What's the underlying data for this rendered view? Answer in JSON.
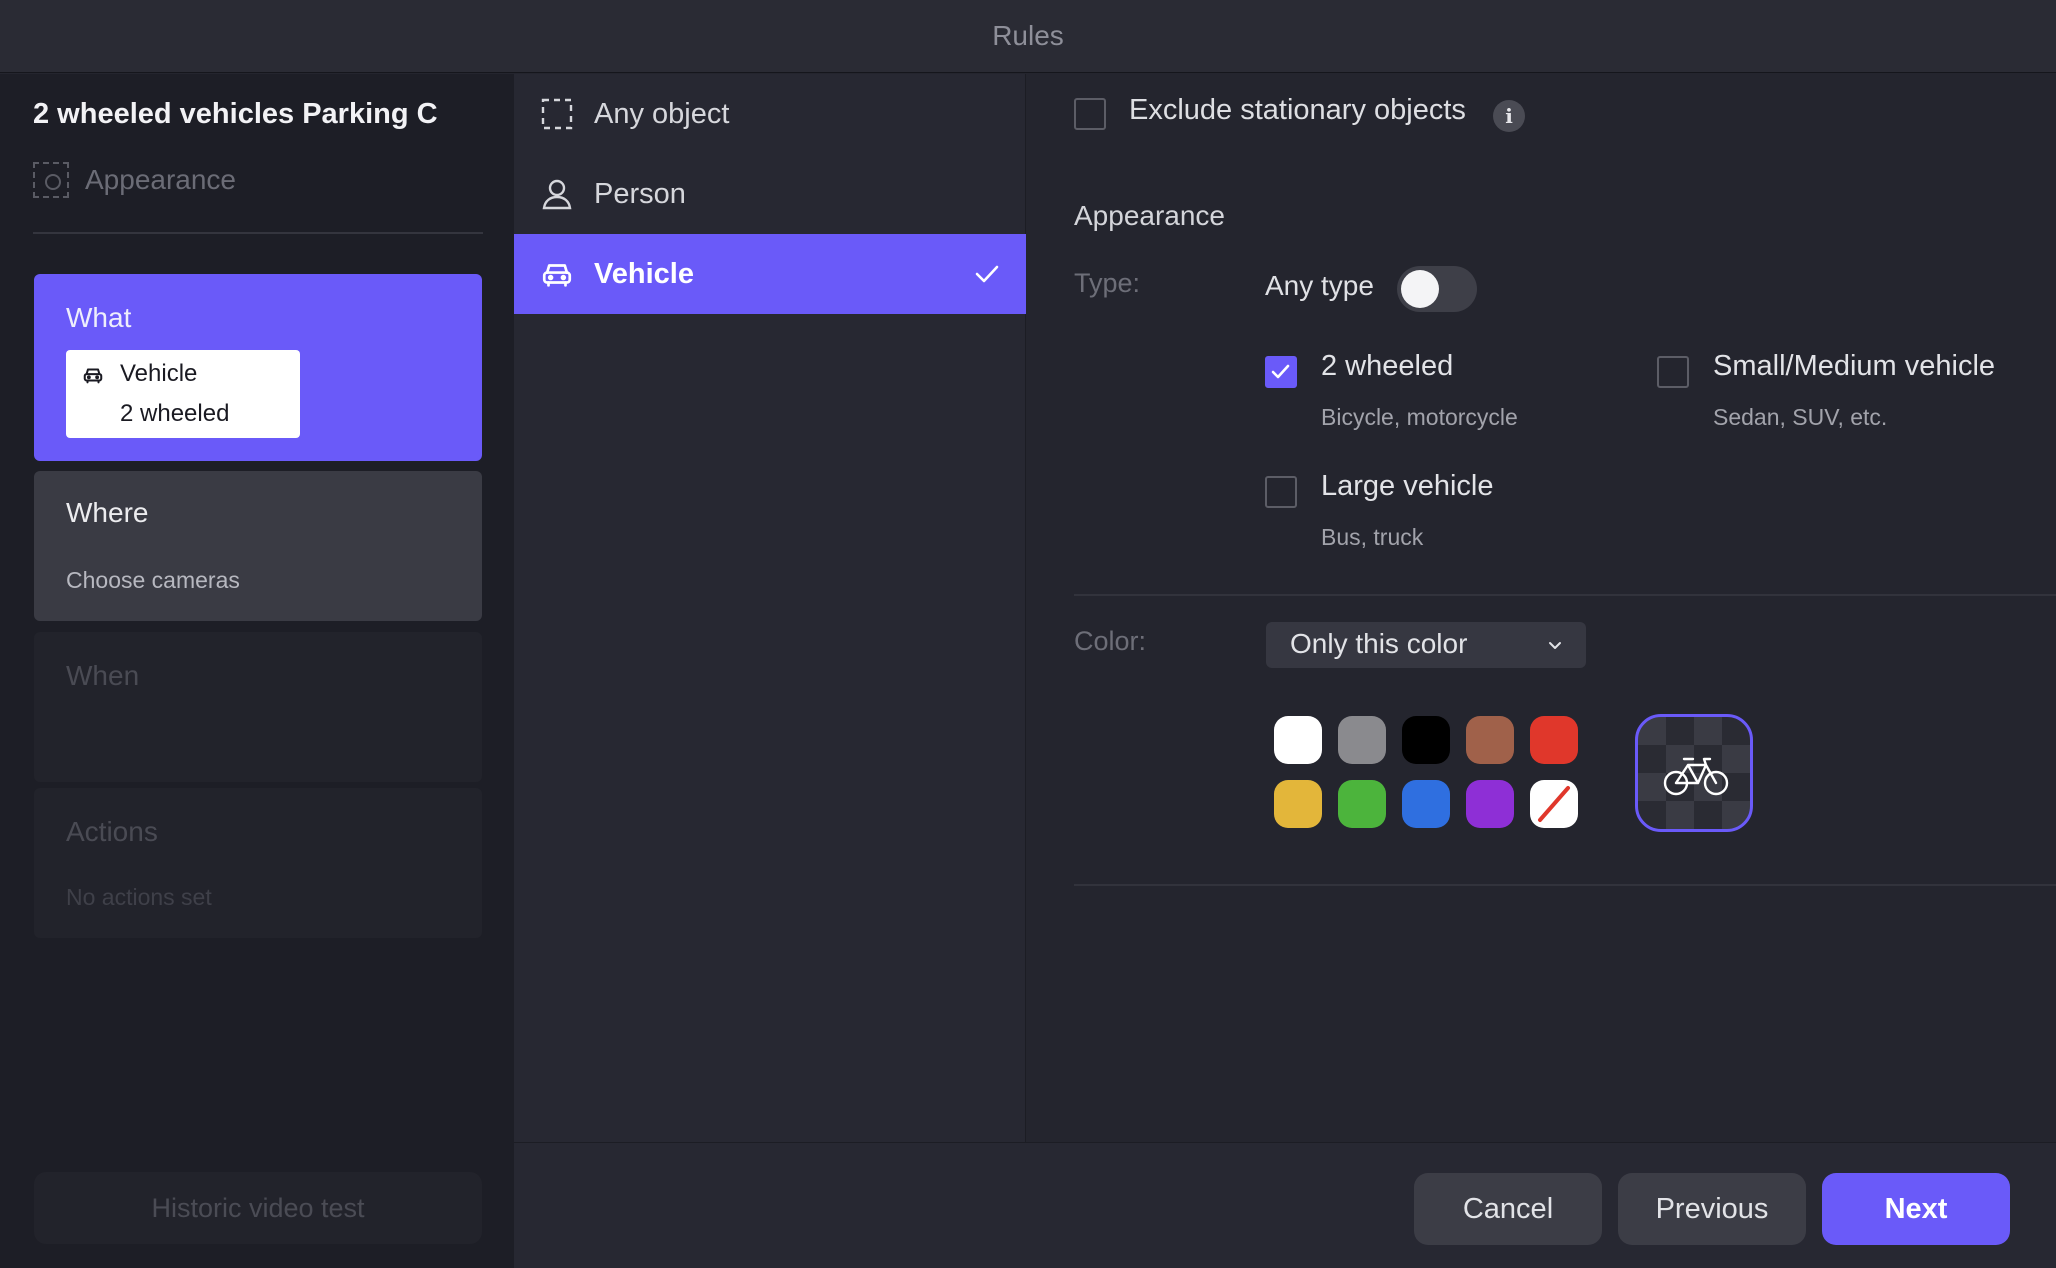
{
  "window": {
    "title": "Rules"
  },
  "sidebar": {
    "rule_name": "2 wheeled vehicles Parking C",
    "rule_subtitle": "Appearance",
    "steps": {
      "what": {
        "title": "What",
        "value_type": "Vehicle",
        "value_subtype": "2 wheeled"
      },
      "where": {
        "title": "Where",
        "detail": "Choose cameras"
      },
      "when": {
        "title": "When"
      },
      "actions": {
        "title": "Actions",
        "detail": "No actions set"
      }
    },
    "historic_button": "Historic video test"
  },
  "object_list": {
    "items": [
      {
        "label": "Any object",
        "icon": "dashed-square-icon",
        "selected": false
      },
      {
        "label": "Person",
        "icon": "person-icon",
        "selected": false
      },
      {
        "label": "Vehicle",
        "icon": "car-icon",
        "selected": true
      }
    ]
  },
  "detail": {
    "exclude_stationary": {
      "label": "Exclude stationary objects",
      "checked": false
    },
    "section_title": "Appearance",
    "type_label": "Type:",
    "any_type": {
      "label": "Any type",
      "on": false
    },
    "options": [
      {
        "title": "2 wheeled",
        "subtitle": "Bicycle, motorcycle",
        "checked": true
      },
      {
        "title": "Small/Medium vehicle",
        "subtitle": "Sedan, SUV, etc.",
        "checked": false
      },
      {
        "title": "Large vehicle",
        "subtitle": "Bus, truck",
        "checked": false
      }
    ],
    "color_label": "Color:",
    "color_mode": "Only this color",
    "swatches": [
      "#ffffff",
      "#8a8a8e",
      "#000000",
      "#a0614a",
      "#e0372b",
      "#e3b63a",
      "#4cb43c",
      "#2f6fe0",
      "#8e2fd6",
      "none"
    ],
    "preview_icon": "bicycle-icon"
  },
  "footer": {
    "cancel": "Cancel",
    "previous": "Previous",
    "next": "Next"
  },
  "colors": {
    "accent": "#6a5af9",
    "background": "#24252e"
  }
}
